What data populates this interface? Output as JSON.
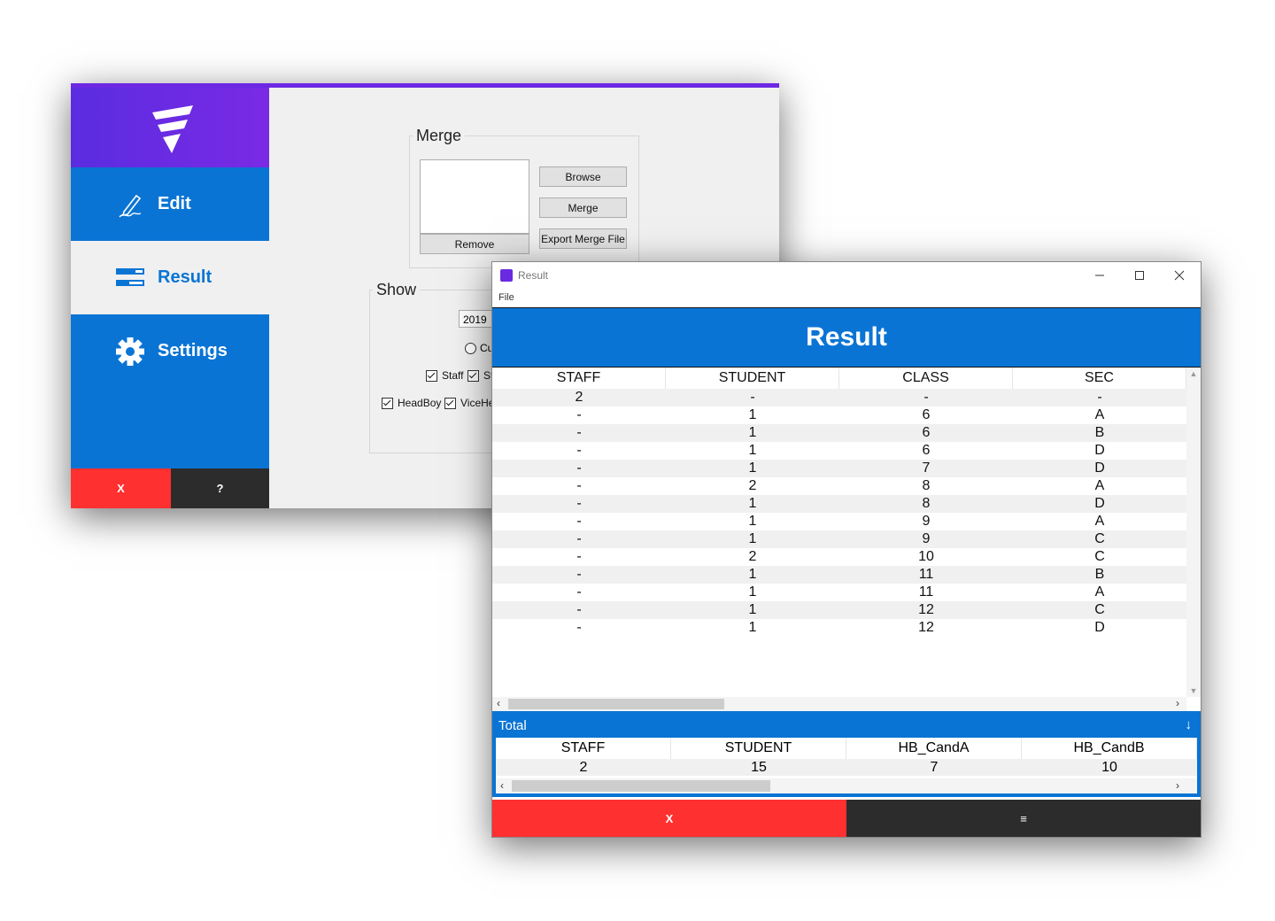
{
  "main_window": {
    "nav": [
      {
        "label": "Edit",
        "icon": "pencil-icon"
      },
      {
        "label": "Result",
        "icon": "bars-icon"
      },
      {
        "label": "Settings",
        "icon": "gear-icon"
      }
    ],
    "close_label": "X",
    "help_label": "?",
    "merge": {
      "title": "Merge",
      "browse_label": "Browse",
      "merge_label": "Merge",
      "export_label": "Export Merge File",
      "remove_label": "Remove"
    },
    "show": {
      "title": "Show",
      "year_value": "2019",
      "radio_label": "Cu",
      "checkboxes": [
        "Staff",
        "St",
        "HeadBoy",
        "ViceHe"
      ]
    },
    "colors": {
      "sidebar": "#0a74d4",
      "logo": "#6d28e3",
      "close": "#ff3030"
    }
  },
  "result_window": {
    "title": "Result",
    "menu": [
      "File"
    ],
    "banner": "Result",
    "columns": [
      "STAFF",
      "STUDENT",
      "CLASS",
      "SEC"
    ],
    "rows": [
      [
        "2",
        "-",
        "-",
        "-"
      ],
      [
        "-",
        "1",
        "6",
        "A"
      ],
      [
        "-",
        "1",
        "6",
        "B"
      ],
      [
        "-",
        "1",
        "6",
        "D"
      ],
      [
        "-",
        "1",
        "7",
        "D"
      ],
      [
        "-",
        "2",
        "8",
        "A"
      ],
      [
        "-",
        "1",
        "8",
        "D"
      ],
      [
        "-",
        "1",
        "9",
        "A"
      ],
      [
        "-",
        "1",
        "9",
        "C"
      ],
      [
        "-",
        "2",
        "10",
        "C"
      ],
      [
        "-",
        "1",
        "11",
        "B"
      ],
      [
        "-",
        "1",
        "11",
        "A"
      ],
      [
        "-",
        "1",
        "12",
        "C"
      ],
      [
        "-",
        "1",
        "12",
        "D"
      ]
    ],
    "total": {
      "label": "Total",
      "arrow": "↓",
      "columns": [
        "STAFF",
        "STUDENT",
        "HB_CandA",
        "HB_CandB"
      ],
      "values": [
        "2",
        "15",
        "7",
        "10"
      ]
    },
    "close_label": "X",
    "menu_label": "≡"
  }
}
